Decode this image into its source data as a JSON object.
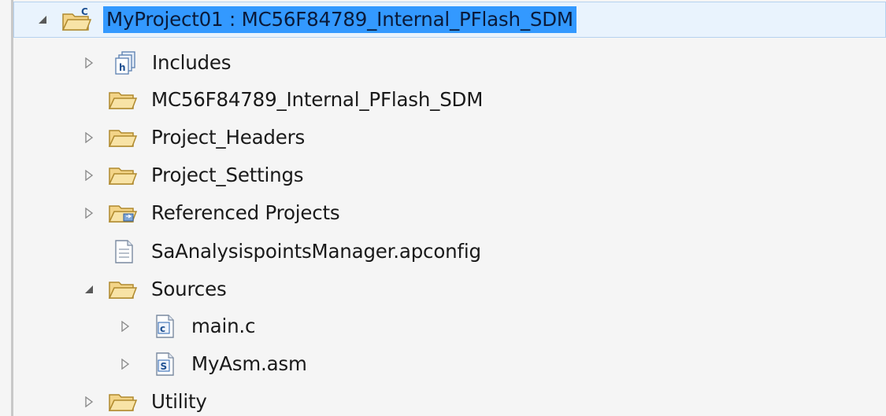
{
  "tree": {
    "items": [
      {
        "label": "MyProject01  :  MC56F84789_Internal_PFlash_SDM",
        "icon": "project-folder-icon",
        "twisty": "expanded",
        "selected": true
      },
      {
        "label": "Includes",
        "icon": "includes-icon",
        "twisty": "collapsed"
      },
      {
        "label": "MC56F84789_Internal_PFlash_SDM",
        "icon": "folder-icon",
        "twisty": "none"
      },
      {
        "label": "Project_Headers",
        "icon": "folder-icon",
        "twisty": "collapsed"
      },
      {
        "label": "Project_Settings",
        "icon": "folder-icon",
        "twisty": "collapsed"
      },
      {
        "label": "Referenced Projects",
        "icon": "referenced-projects-folder-icon",
        "twisty": "collapsed"
      },
      {
        "label": "SaAnalysispointsManager.apconfig",
        "icon": "file-icon",
        "twisty": "none"
      },
      {
        "label": "Sources",
        "icon": "folder-icon",
        "twisty": "expanded"
      },
      {
        "label": "main.c",
        "icon": "c-file-icon",
        "twisty": "collapsed"
      },
      {
        "label": "MyAsm.asm",
        "icon": "asm-file-icon",
        "twisty": "collapsed"
      },
      {
        "label": "Utility",
        "icon": "folder-icon",
        "twisty": "collapsed"
      }
    ]
  },
  "colors": {
    "selection_fill": "#3399ff",
    "row_highlight": "#e9f3fd",
    "folder_fill": "#f3d488",
    "folder_stroke": "#b08a2e"
  }
}
